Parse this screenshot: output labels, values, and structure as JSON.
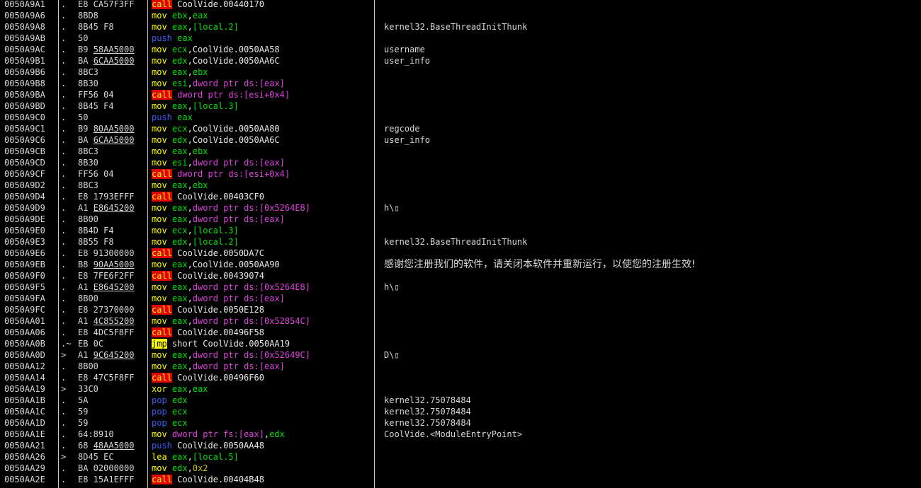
{
  "rows": [
    {
      "addr": "0050A9A1",
      "mark": ".",
      "hex": "E8 CA57F3FF",
      "mn": "call",
      "ops": [
        [
          "CoolVide.00440170",
          "plain"
        ]
      ],
      "cmt": ""
    },
    {
      "addr": "0050A9A6",
      "mark": ".",
      "hex": "8BD8",
      "mn": "mov",
      "ops": [
        [
          "ebx",
          "reg"
        ],
        [
          ",",
          "plain"
        ],
        [
          "eax",
          "reg"
        ]
      ],
      "cmt": ""
    },
    {
      "addr": "0050A9A8",
      "mark": ".",
      "hex": "8B45 F8",
      "mn": "mov",
      "ops": [
        [
          "eax",
          "reg"
        ],
        [
          ",",
          "plain"
        ],
        [
          "[local.2]",
          "reg"
        ]
      ],
      "cmt": "kernel32.BaseThreadInitThunk"
    },
    {
      "addr": "0050A9AB",
      "mark": ".",
      "hex": "50",
      "mn": "push",
      "ops": [
        [
          "eax",
          "reg"
        ]
      ],
      "cmt": ""
    },
    {
      "addr": "0050A9AC",
      "mark": ".",
      "hex": "B9 ",
      "hexu": "58AA5000",
      "mn": "mov",
      "ops": [
        [
          "ecx",
          "reg"
        ],
        [
          ",CoolVide.0050AA58",
          "plain"
        ]
      ],
      "cmt": "username"
    },
    {
      "addr": "0050A9B1",
      "mark": ".",
      "hex": "BA ",
      "hexu": "6CAA5000",
      "mn": "mov",
      "ops": [
        [
          "edx",
          "reg"
        ],
        [
          ",CoolVide.0050AA6C",
          "plain"
        ]
      ],
      "cmt": "user_info"
    },
    {
      "addr": "0050A9B6",
      "mark": ".",
      "hex": "8BC3",
      "mn": "mov",
      "ops": [
        [
          "eax",
          "reg"
        ],
        [
          ",",
          "plain"
        ],
        [
          "ebx",
          "reg"
        ]
      ],
      "cmt": ""
    },
    {
      "addr": "0050A9B8",
      "mark": ".",
      "hex": "8B30",
      "mn": "mov",
      "ops": [
        [
          "esi",
          "reg"
        ],
        [
          ",",
          "plain"
        ],
        [
          "dword ptr ds:[eax]",
          "mem"
        ]
      ],
      "cmt": ""
    },
    {
      "addr": "0050A9BA",
      "mark": ".",
      "hex": "FF56 04",
      "mn": "call",
      "ops": [
        [
          "dword ptr ds:[esi+0x4]",
          "mem"
        ]
      ],
      "cmt": ""
    },
    {
      "addr": "0050A9BD",
      "mark": ".",
      "hex": "8B45 F4",
      "mn": "mov",
      "ops": [
        [
          "eax",
          "reg"
        ],
        [
          ",",
          "plain"
        ],
        [
          "[local.3]",
          "reg"
        ]
      ],
      "cmt": ""
    },
    {
      "addr": "0050A9C0",
      "mark": ".",
      "hex": "50",
      "mn": "push",
      "ops": [
        [
          "eax",
          "reg"
        ]
      ],
      "cmt": ""
    },
    {
      "addr": "0050A9C1",
      "mark": ".",
      "hex": "B9 ",
      "hexu": "80AA5000",
      "mn": "mov",
      "ops": [
        [
          "ecx",
          "reg"
        ],
        [
          ",CoolVide.0050AA80",
          "plain"
        ]
      ],
      "cmt": "regcode"
    },
    {
      "addr": "0050A9C6",
      "mark": ".",
      "hex": "BA ",
      "hexu": "6CAA5000",
      "mn": "mov",
      "ops": [
        [
          "edx",
          "reg"
        ],
        [
          ",CoolVide.0050AA6C",
          "plain"
        ]
      ],
      "cmt": "user_info"
    },
    {
      "addr": "0050A9CB",
      "mark": ".",
      "hex": "8BC3",
      "mn": "mov",
      "ops": [
        [
          "eax",
          "reg"
        ],
        [
          ",",
          "plain"
        ],
        [
          "ebx",
          "reg"
        ]
      ],
      "cmt": ""
    },
    {
      "addr": "0050A9CD",
      "mark": ".",
      "hex": "8B30",
      "mn": "mov",
      "ops": [
        [
          "esi",
          "reg"
        ],
        [
          ",",
          "plain"
        ],
        [
          "dword ptr ds:[eax]",
          "mem"
        ]
      ],
      "cmt": ""
    },
    {
      "addr": "0050A9CF",
      "mark": ".",
      "hex": "FF56 04",
      "mn": "call",
      "ops": [
        [
          "dword ptr ds:[esi+0x4]",
          "mem"
        ]
      ],
      "cmt": ""
    },
    {
      "addr": "0050A9D2",
      "mark": ".",
      "hex": "8BC3",
      "mn": "mov",
      "ops": [
        [
          "eax",
          "reg"
        ],
        [
          ",",
          "plain"
        ],
        [
          "ebx",
          "reg"
        ]
      ],
      "cmt": ""
    },
    {
      "addr": "0050A9D4",
      "mark": ".",
      "hex": "E8 1793EFFF",
      "mn": "call",
      "ops": [
        [
          "CoolVide.00403CF0",
          "plain"
        ]
      ],
      "cmt": ""
    },
    {
      "addr": "0050A9D9",
      "mark": ".",
      "hex": "A1 ",
      "hexu": "E8645200",
      "mn": "mov",
      "ops": [
        [
          "eax",
          "reg"
        ],
        [
          ",",
          "plain"
        ],
        [
          "dword ptr ds:[0x5264E8]",
          "mem"
        ]
      ],
      "cmt": "h\\▯"
    },
    {
      "addr": "0050A9DE",
      "mark": ".",
      "hex": "8B00",
      "mn": "mov",
      "ops": [
        [
          "eax",
          "reg"
        ],
        [
          ",",
          "plain"
        ],
        [
          "dword ptr ds:[eax]",
          "mem"
        ]
      ],
      "cmt": ""
    },
    {
      "addr": "0050A9E0",
      "mark": ".",
      "hex": "8B4D F4",
      "mn": "mov",
      "ops": [
        [
          "ecx",
          "reg"
        ],
        [
          ",",
          "plain"
        ],
        [
          "[local.3]",
          "reg"
        ]
      ],
      "cmt": ""
    },
    {
      "addr": "0050A9E3",
      "mark": ".",
      "hex": "8B55 F8",
      "mn": "mov",
      "ops": [
        [
          "edx",
          "reg"
        ],
        [
          ",",
          "plain"
        ],
        [
          "[local.2]",
          "reg"
        ]
      ],
      "cmt": "kernel32.BaseThreadInitThunk"
    },
    {
      "addr": "0050A9E6",
      "mark": ".",
      "hex": "E8 91300000",
      "mn": "call",
      "ops": [
        [
          "CoolVide.0050DA7C",
          "plain"
        ]
      ],
      "cmt": ""
    },
    {
      "addr": "0050A9EB",
      "mark": ".",
      "hex": "B8 ",
      "hexu": "90AA5000",
      "mn": "mov",
      "ops": [
        [
          "eax",
          "reg"
        ],
        [
          ",CoolVide.0050AA90",
          "plain"
        ]
      ],
      "cmt": "感谢您注册我们的软件，请关闭本软件并重新运行，以使您的注册生效!"
    },
    {
      "addr": "0050A9F0",
      "mark": ".",
      "hex": "E8 7FE6F2FF",
      "mn": "call",
      "ops": [
        [
          "CoolVide.00439074",
          "plain"
        ]
      ],
      "cmt": ""
    },
    {
      "addr": "0050A9F5",
      "mark": ".",
      "hex": "A1 ",
      "hexu": "E8645200",
      "mn": "mov",
      "ops": [
        [
          "eax",
          "reg"
        ],
        [
          ",",
          "plain"
        ],
        [
          "dword ptr ds:[0x5264E8]",
          "mem"
        ]
      ],
      "cmt": "h\\▯"
    },
    {
      "addr": "0050A9FA",
      "mark": ".",
      "hex": "8B00",
      "mn": "mov",
      "ops": [
        [
          "eax",
          "reg"
        ],
        [
          ",",
          "plain"
        ],
        [
          "dword ptr ds:[eax]",
          "mem"
        ]
      ],
      "cmt": ""
    },
    {
      "addr": "0050A9FC",
      "mark": ".",
      "hex": "E8 27370000",
      "mn": "call",
      "ops": [
        [
          "CoolVide.0050E128",
          "plain"
        ]
      ],
      "cmt": ""
    },
    {
      "addr": "0050AA01",
      "mark": ".",
      "hex": "A1 ",
      "hexu": "4C855200",
      "mn": "mov",
      "ops": [
        [
          "eax",
          "reg"
        ],
        [
          ",",
          "plain"
        ],
        [
          "dword ptr ds:[0x52854C]",
          "mem"
        ]
      ],
      "cmt": ""
    },
    {
      "addr": "0050AA06",
      "mark": ".",
      "hex": "E8 4DC5F8FF",
      "mn": "call",
      "ops": [
        [
          "CoolVide.00496F58",
          "plain"
        ]
      ],
      "cmt": ""
    },
    {
      "addr": "0050AA0B",
      "mark": ".~",
      "hex": "EB 0C",
      "mn": "jmp",
      "ops": [
        [
          "short CoolVide.0050AA19",
          "plain"
        ]
      ],
      "cmt": ""
    },
    {
      "addr": "0050AA0D",
      "mark": ">",
      "hex": "A1 ",
      "hexu": "9C645200",
      "mn": "mov",
      "ops": [
        [
          "eax",
          "reg"
        ],
        [
          ",",
          "plain"
        ],
        [
          "dword ptr ds:[0x52649C]",
          "mem"
        ]
      ],
      "cmt": "D\\▯"
    },
    {
      "addr": "0050AA12",
      "mark": ".",
      "hex": "8B00",
      "mn": "mov",
      "ops": [
        [
          "eax",
          "reg"
        ],
        [
          ",",
          "plain"
        ],
        [
          "dword ptr ds:[eax]",
          "mem"
        ]
      ],
      "cmt": ""
    },
    {
      "addr": "0050AA14",
      "mark": ".",
      "hex": "E8 47C5F8FF",
      "mn": "call",
      "ops": [
        [
          "CoolVide.00496F60",
          "plain"
        ]
      ],
      "cmt": ""
    },
    {
      "addr": "0050AA19",
      "mark": ">",
      "hex": "33C0",
      "mn": "xor",
      "ops": [
        [
          "eax",
          "reg"
        ],
        [
          ",",
          "plain"
        ],
        [
          "eax",
          "reg"
        ]
      ],
      "cmt": ""
    },
    {
      "addr": "0050AA1B",
      "mark": ".",
      "hex": "5A",
      "mn": "pop",
      "ops": [
        [
          "edx",
          "reg"
        ]
      ],
      "cmt": "kernel32.75078484"
    },
    {
      "addr": "0050AA1C",
      "mark": ".",
      "hex": "59",
      "mn": "pop",
      "ops": [
        [
          "ecx",
          "reg"
        ]
      ],
      "cmt": "kernel32.75078484"
    },
    {
      "addr": "0050AA1D",
      "mark": ".",
      "hex": "59",
      "mn": "pop",
      "ops": [
        [
          "ecx",
          "reg"
        ]
      ],
      "cmt": "kernel32.75078484"
    },
    {
      "addr": "0050AA1E",
      "mark": ".",
      "hex": "64:8910",
      "mn": "mov",
      "ops": [
        [
          "dword ptr fs:[eax]",
          "mem"
        ],
        [
          ",",
          "plain"
        ],
        [
          "edx",
          "reg"
        ]
      ],
      "cmt": "CoolVide.<ModuleEntryPoint>"
    },
    {
      "addr": "0050AA21",
      "mark": ".",
      "hex": "68 ",
      "hexu": "48AA5000",
      "mn": "push",
      "ops": [
        [
          "CoolVide.0050AA48",
          "plain"
        ]
      ],
      "cmt": ""
    },
    {
      "addr": "0050AA26",
      "mark": ">",
      "hex": "8D45 EC",
      "mn": "lea",
      "ops": [
        [
          "eax",
          "reg"
        ],
        [
          ",",
          "plain"
        ],
        [
          "[local.5]",
          "reg"
        ]
      ],
      "cmt": ""
    },
    {
      "addr": "0050AA29",
      "mark": ".",
      "hex": "BA 02000000",
      "mn": "mov",
      "ops": [
        [
          "edx",
          "reg"
        ],
        [
          ",",
          "plain"
        ],
        [
          "0x2",
          "imm"
        ]
      ],
      "cmt": ""
    },
    {
      "addr": "0050AA2E",
      "mark": ".",
      "hex": "E8 15A1EFFF",
      "mn": "call",
      "ops": [
        [
          "CoolVide.00404B48",
          "plain"
        ]
      ],
      "cmt": ""
    }
  ]
}
